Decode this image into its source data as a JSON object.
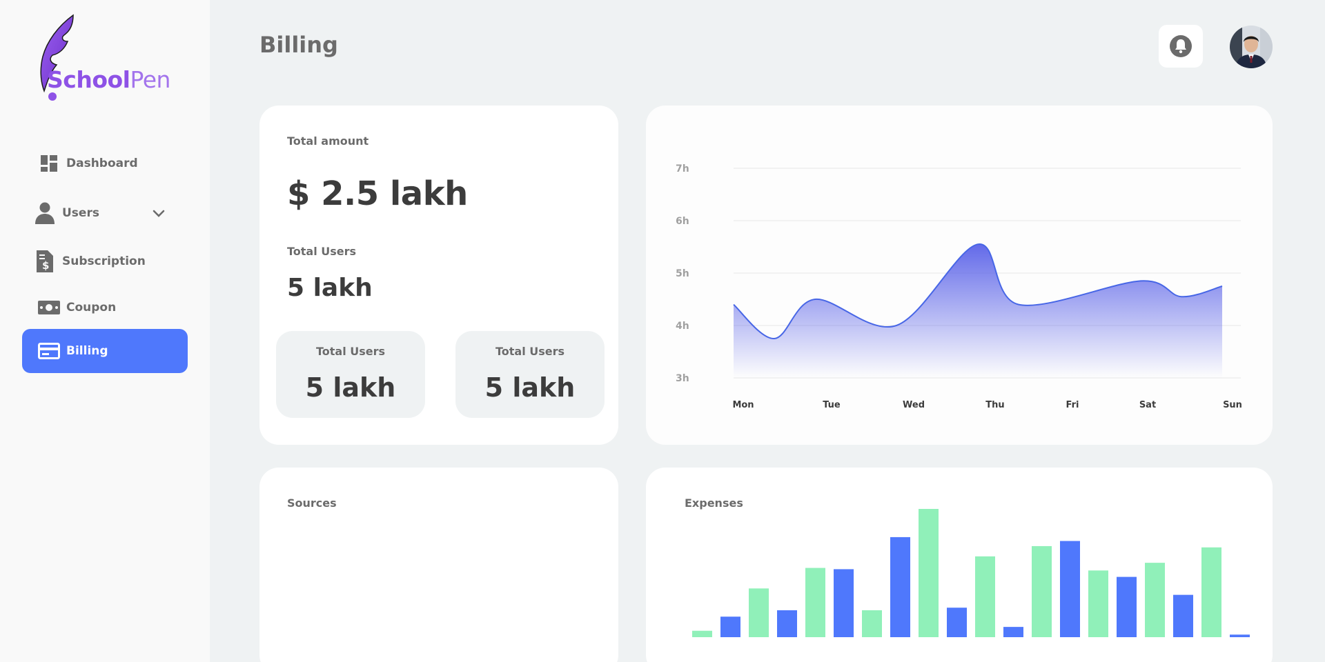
{
  "brand": {
    "name_bold": "School",
    "name_light": "Pen"
  },
  "sidebar": {
    "items": [
      {
        "label": "Dashboard",
        "icon": "dashboard-icon"
      },
      {
        "label": "Users",
        "icon": "user-icon",
        "has_submenu": true
      },
      {
        "label": "Subscription",
        "icon": "invoice-icon"
      },
      {
        "label": "Coupon",
        "icon": "banknote-icon"
      },
      {
        "label": "Billing",
        "icon": "credit-card-icon",
        "active": true
      }
    ]
  },
  "header": {
    "title": "Billing",
    "notification_icon": "bell-icon"
  },
  "stats": {
    "total_amount_label": "Total amount",
    "total_amount_value": "$ 2.5 lakh",
    "total_users_label": "Total Users",
    "total_users_value": "5 lakh",
    "mini": [
      {
        "label": "Total Users",
        "value": "5 lakh"
      },
      {
        "label": "Total Users",
        "value": "5 lakh"
      }
    ]
  },
  "sources": {
    "title": "Sources"
  },
  "expenses": {
    "title": "Expenses"
  },
  "colors": {
    "accent": "#4f78fc",
    "green": "#90f0b9",
    "area_top": "#5a62e8",
    "line": "#4766e6",
    "brand_purple": "#8e52e6"
  },
  "chart_data": [
    {
      "type": "area",
      "title": "",
      "xlabel": "",
      "ylabel": "",
      "categories": [
        "Mon",
        "Tue",
        "Wed",
        "Thu",
        "Fri",
        "Sat",
        "Sun"
      ],
      "y_ticks": [
        "3h",
        "4h",
        "5h",
        "6h",
        "7h"
      ],
      "ylim": [
        3,
        7
      ],
      "grid": true,
      "points": [
        {
          "x": "Mon",
          "y": 4.4
        },
        {
          "x": "Mon-Tue",
          "y": 3.75
        },
        {
          "x": "Tue",
          "y": 4.5
        },
        {
          "x": "Wed",
          "y": 4.0
        },
        {
          "x": "Thu",
          "y": 5.55
        },
        {
          "x": "Thu-Fri",
          "y": 4.4
        },
        {
          "x": "Sat",
          "y": 4.85
        },
        {
          "x": "Sat-Sun",
          "y": 4.55
        },
        {
          "x": "Sun",
          "y": 4.75
        }
      ]
    },
    {
      "type": "bar",
      "title": "Expenses",
      "series_colors": [
        "green",
        "blue"
      ],
      "bars": [
        {
          "color": "green",
          "value": 0.05
        },
        {
          "color": "blue",
          "value": 0.16
        },
        {
          "color": "green",
          "value": 0.38
        },
        {
          "color": "blue",
          "value": 0.21
        },
        {
          "color": "green",
          "value": 0.54
        },
        {
          "color": "blue",
          "value": 0.53
        },
        {
          "color": "green",
          "value": 0.21
        },
        {
          "color": "blue",
          "value": 0.78
        },
        {
          "color": "green",
          "value": 1.0
        },
        {
          "color": "blue",
          "value": 0.23
        },
        {
          "color": "green",
          "value": 0.63
        },
        {
          "color": "blue",
          "value": 0.08
        },
        {
          "color": "green",
          "value": 0.71
        },
        {
          "color": "blue",
          "value": 0.75
        },
        {
          "color": "green",
          "value": 0.52
        },
        {
          "color": "blue",
          "value": 0.47
        },
        {
          "color": "green",
          "value": 0.58
        },
        {
          "color": "blue",
          "value": 0.33
        },
        {
          "color": "green",
          "value": 0.7
        },
        {
          "color": "blue",
          "value": 0.02
        }
      ]
    }
  ]
}
